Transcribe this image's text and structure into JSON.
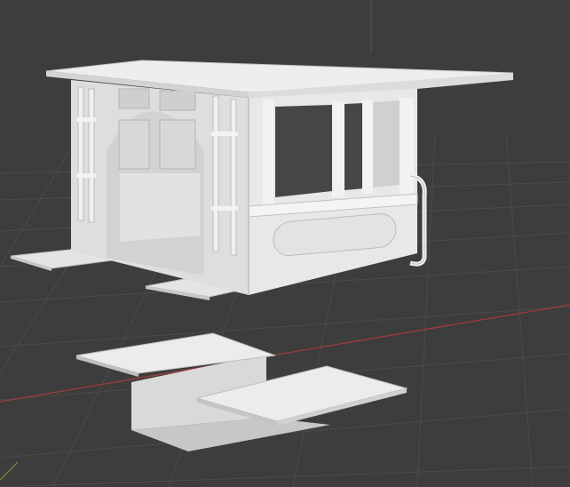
{
  "viewport": {
    "background": "#3d3d3d",
    "grid_color": "#4a4a4a",
    "x_axis_color": "#b04040",
    "y_axis_color": "#6a8f3a",
    "model_fill": "#e6e6e6",
    "model_shade": "#cfcfcf",
    "model_dark": "#bdbdbd"
  },
  "scene": {
    "objects": [
      {
        "name": "tram-cab-body"
      },
      {
        "name": "roof"
      },
      {
        "name": "left-step"
      },
      {
        "name": "right-step"
      },
      {
        "name": "floor-base"
      }
    ]
  }
}
